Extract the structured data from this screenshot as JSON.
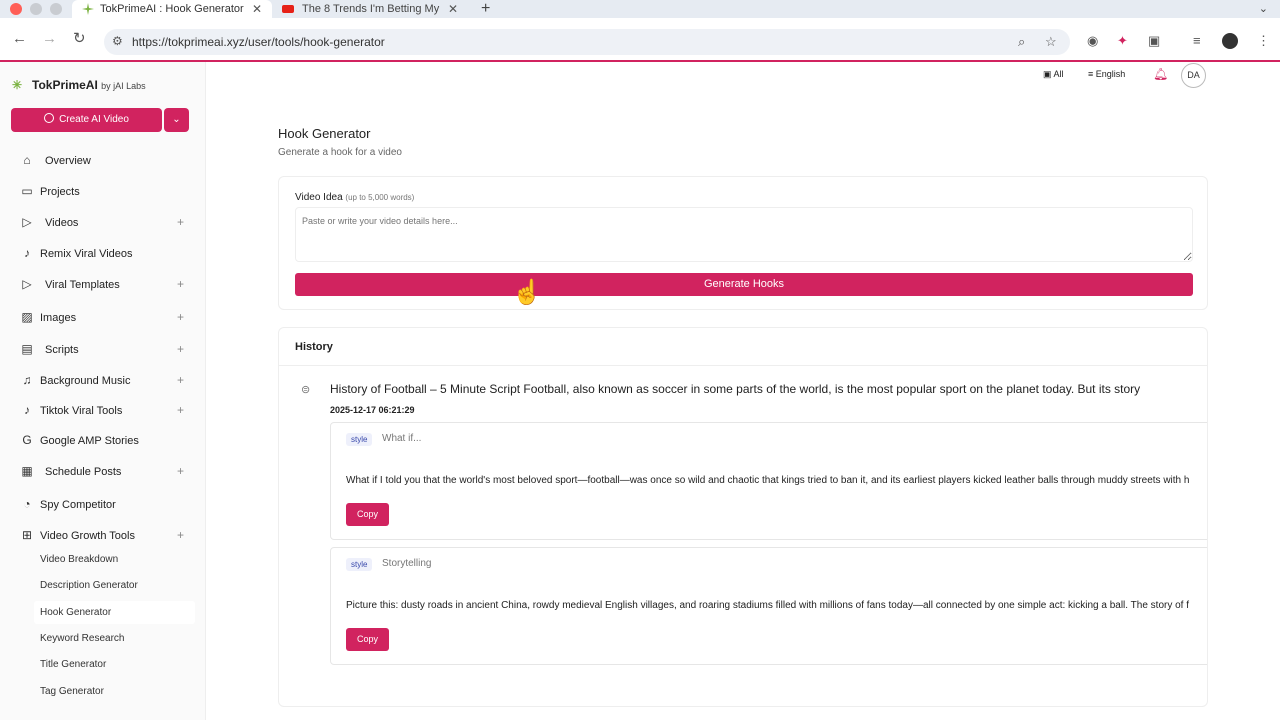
{
  "browser": {
    "tabs": [
      {
        "title": "TokPrimeAI : Hook Generator",
        "active": true
      },
      {
        "title": "The 8 Trends I'm Betting My",
        "active": false
      }
    ],
    "url": "https://tokprimeai.xyz/user/tools/hook-generator"
  },
  "brand": {
    "name": "TokPrimeAI",
    "by": "by jAI Labs"
  },
  "sidebar": {
    "create_label": "Create AI Video",
    "items": [
      {
        "label": "Overview",
        "icon": "home-icon",
        "expandable": false
      },
      {
        "label": "Projects",
        "icon": "folder-icon",
        "expandable": false
      },
      {
        "label": "Videos",
        "icon": "play-circle-icon",
        "expandable": true
      },
      {
        "label": "Remix Viral Videos",
        "icon": "tiktok-icon",
        "expandable": false
      },
      {
        "label": "Viral Templates",
        "icon": "play-circle-icon",
        "expandable": true
      },
      {
        "label": "Images",
        "icon": "image-icon",
        "expandable": true
      },
      {
        "label": "Scripts",
        "icon": "document-icon",
        "expandable": true
      },
      {
        "label": "Background Music",
        "icon": "music-icon",
        "expandable": true
      },
      {
        "label": "Tiktok Viral Tools",
        "icon": "tiktok-icon",
        "expandable": true
      },
      {
        "label": "Google AMP Stories",
        "icon": "google-icon",
        "expandable": false
      },
      {
        "label": "Schedule Posts",
        "icon": "calendar-icon",
        "expandable": true
      },
      {
        "label": "Spy Competitor",
        "icon": "spy-icon",
        "expandable": false
      },
      {
        "label": "Video Growth Tools",
        "icon": "grid-icon",
        "expandable": true
      }
    ],
    "subitems": [
      "Video Breakdown",
      "Description Generator",
      "Hook Generator",
      "Keyword Research",
      "Title Generator",
      "Tag Generator"
    ],
    "active_subitem": "Hook Generator"
  },
  "header": {
    "all_label": "All",
    "language": "English",
    "avatar": "DA"
  },
  "page": {
    "title": "Hook Generator",
    "subtitle": "Generate a hook for a video",
    "video_idea_label": "Video Idea",
    "video_idea_hint": "(up to 5,000 words)",
    "video_idea_placeholder": "Paste or write your video details here...",
    "generate_label": "Generate Hooks"
  },
  "history": {
    "title": "History",
    "entry": {
      "headline": "History of Football – 5 Minute Script Football, also known as soccer in some parts of the world, is the most popular sport on the planet today. But its story",
      "date": "2025-12-17 06:21:29",
      "hooks": [
        {
          "style_tag": "style",
          "style": "What if...",
          "text": "What if I told you that the world's most beloved sport—football—was once so wild and chaotic that kings tried to ban it, and its earliest players kicked leather balls through muddy streets with h",
          "copy_label": "Copy"
        },
        {
          "style_tag": "style",
          "style": "Storytelling",
          "text": "Picture this: dusty roads in ancient China, rowdy medieval English villages, and roaring stadiums filled with millions of fans today—all connected by one simple act: kicking a ball. The story of f",
          "copy_label": "Copy"
        }
      ]
    }
  },
  "colors": {
    "accent": "#d1235f",
    "brand_green": "#7cb342"
  }
}
